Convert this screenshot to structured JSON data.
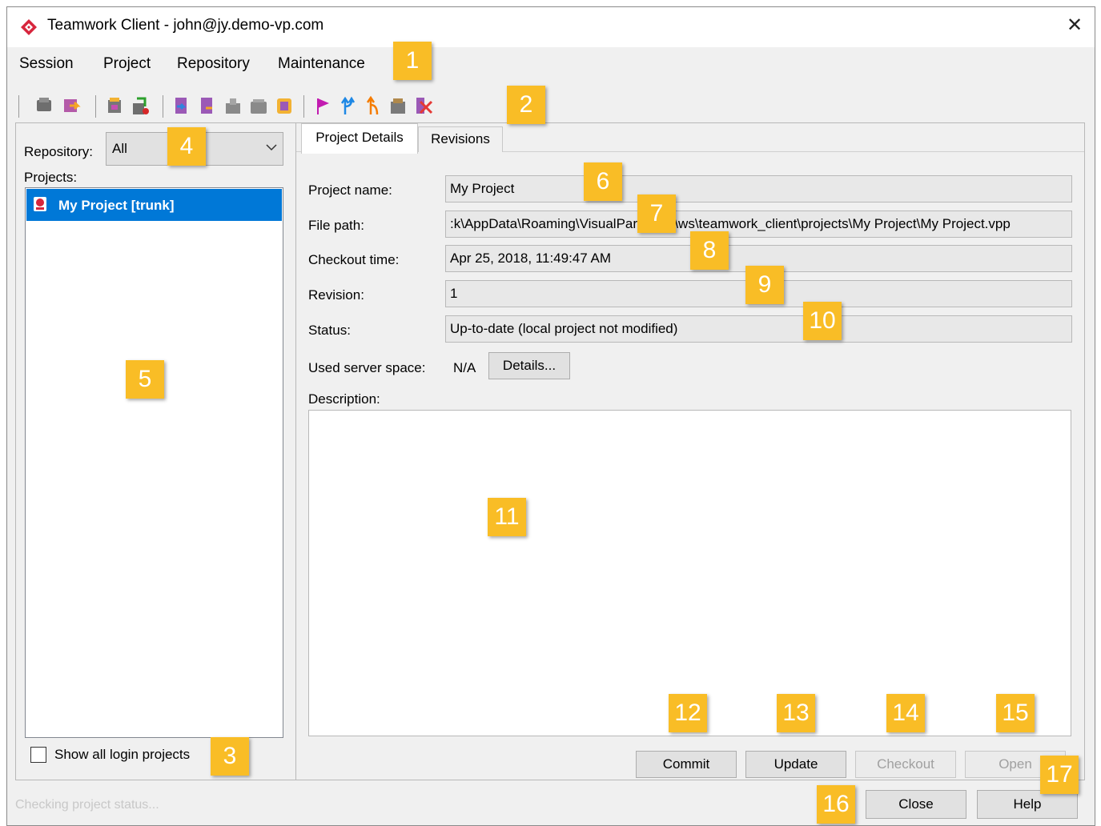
{
  "window": {
    "title": "Teamwork Client - john@jy.demo-vp.com",
    "close_icon": "close-icon",
    "app_icon": "visual-paradigm-logo-icon"
  },
  "menubar": {
    "items": [
      "Session",
      "Project",
      "Repository",
      "Maintenance"
    ]
  },
  "toolbar": {
    "icons": [
      "commit-icon",
      "update-icon",
      "import-project-icon",
      "export-project-icon",
      "checkout-icon",
      "revert-icon",
      "lock-icon",
      "unlock-icon",
      "open-project-icon",
      "tag-icon",
      "branch-icon",
      "merge-icon",
      "archive-icon",
      "delete-icon"
    ]
  },
  "left": {
    "repository_label": "Repository:",
    "repository_value": "All",
    "projects_label": "Projects:",
    "projects": [
      "My Project [trunk]"
    ],
    "show_all_label": "Show all login projects",
    "show_all_checked": false
  },
  "tabs": {
    "project_details": "Project Details",
    "revisions": "Revisions"
  },
  "details": {
    "project_name_label": "Project name:",
    "project_name": "My Project",
    "file_path_label": "File path:",
    "file_path": ":k\\AppData\\Roaming\\VisualParadigm\\ws\\teamwork_client\\projects\\My Project\\My Project.vpp",
    "checkout_time_label": "Checkout time:",
    "checkout_time": "Apr 25, 2018, 11:49:47 AM",
    "revision_label": "Revision:",
    "revision": "1",
    "status_label": "Status:",
    "status": "Up-to-date (local project not modified)",
    "used_space_label": "Used server space:",
    "used_space": "N/A",
    "details_button": "Details...",
    "description_label": "Description:"
  },
  "actions": {
    "commit": "Commit",
    "update": "Update",
    "checkout": "Checkout",
    "open": "Open"
  },
  "footer": {
    "status_text": "Checking project status...",
    "close": "Close",
    "help": "Help"
  },
  "callouts": [
    "1",
    "2",
    "3",
    "4",
    "5",
    "6",
    "7",
    "8",
    "9",
    "10",
    "11",
    "12",
    "13",
    "14",
    "15",
    "16",
    "17"
  ],
  "colors": {
    "callout": "#f9bd26",
    "selection": "#0078d7",
    "window_bg": "#f0f0f0"
  }
}
